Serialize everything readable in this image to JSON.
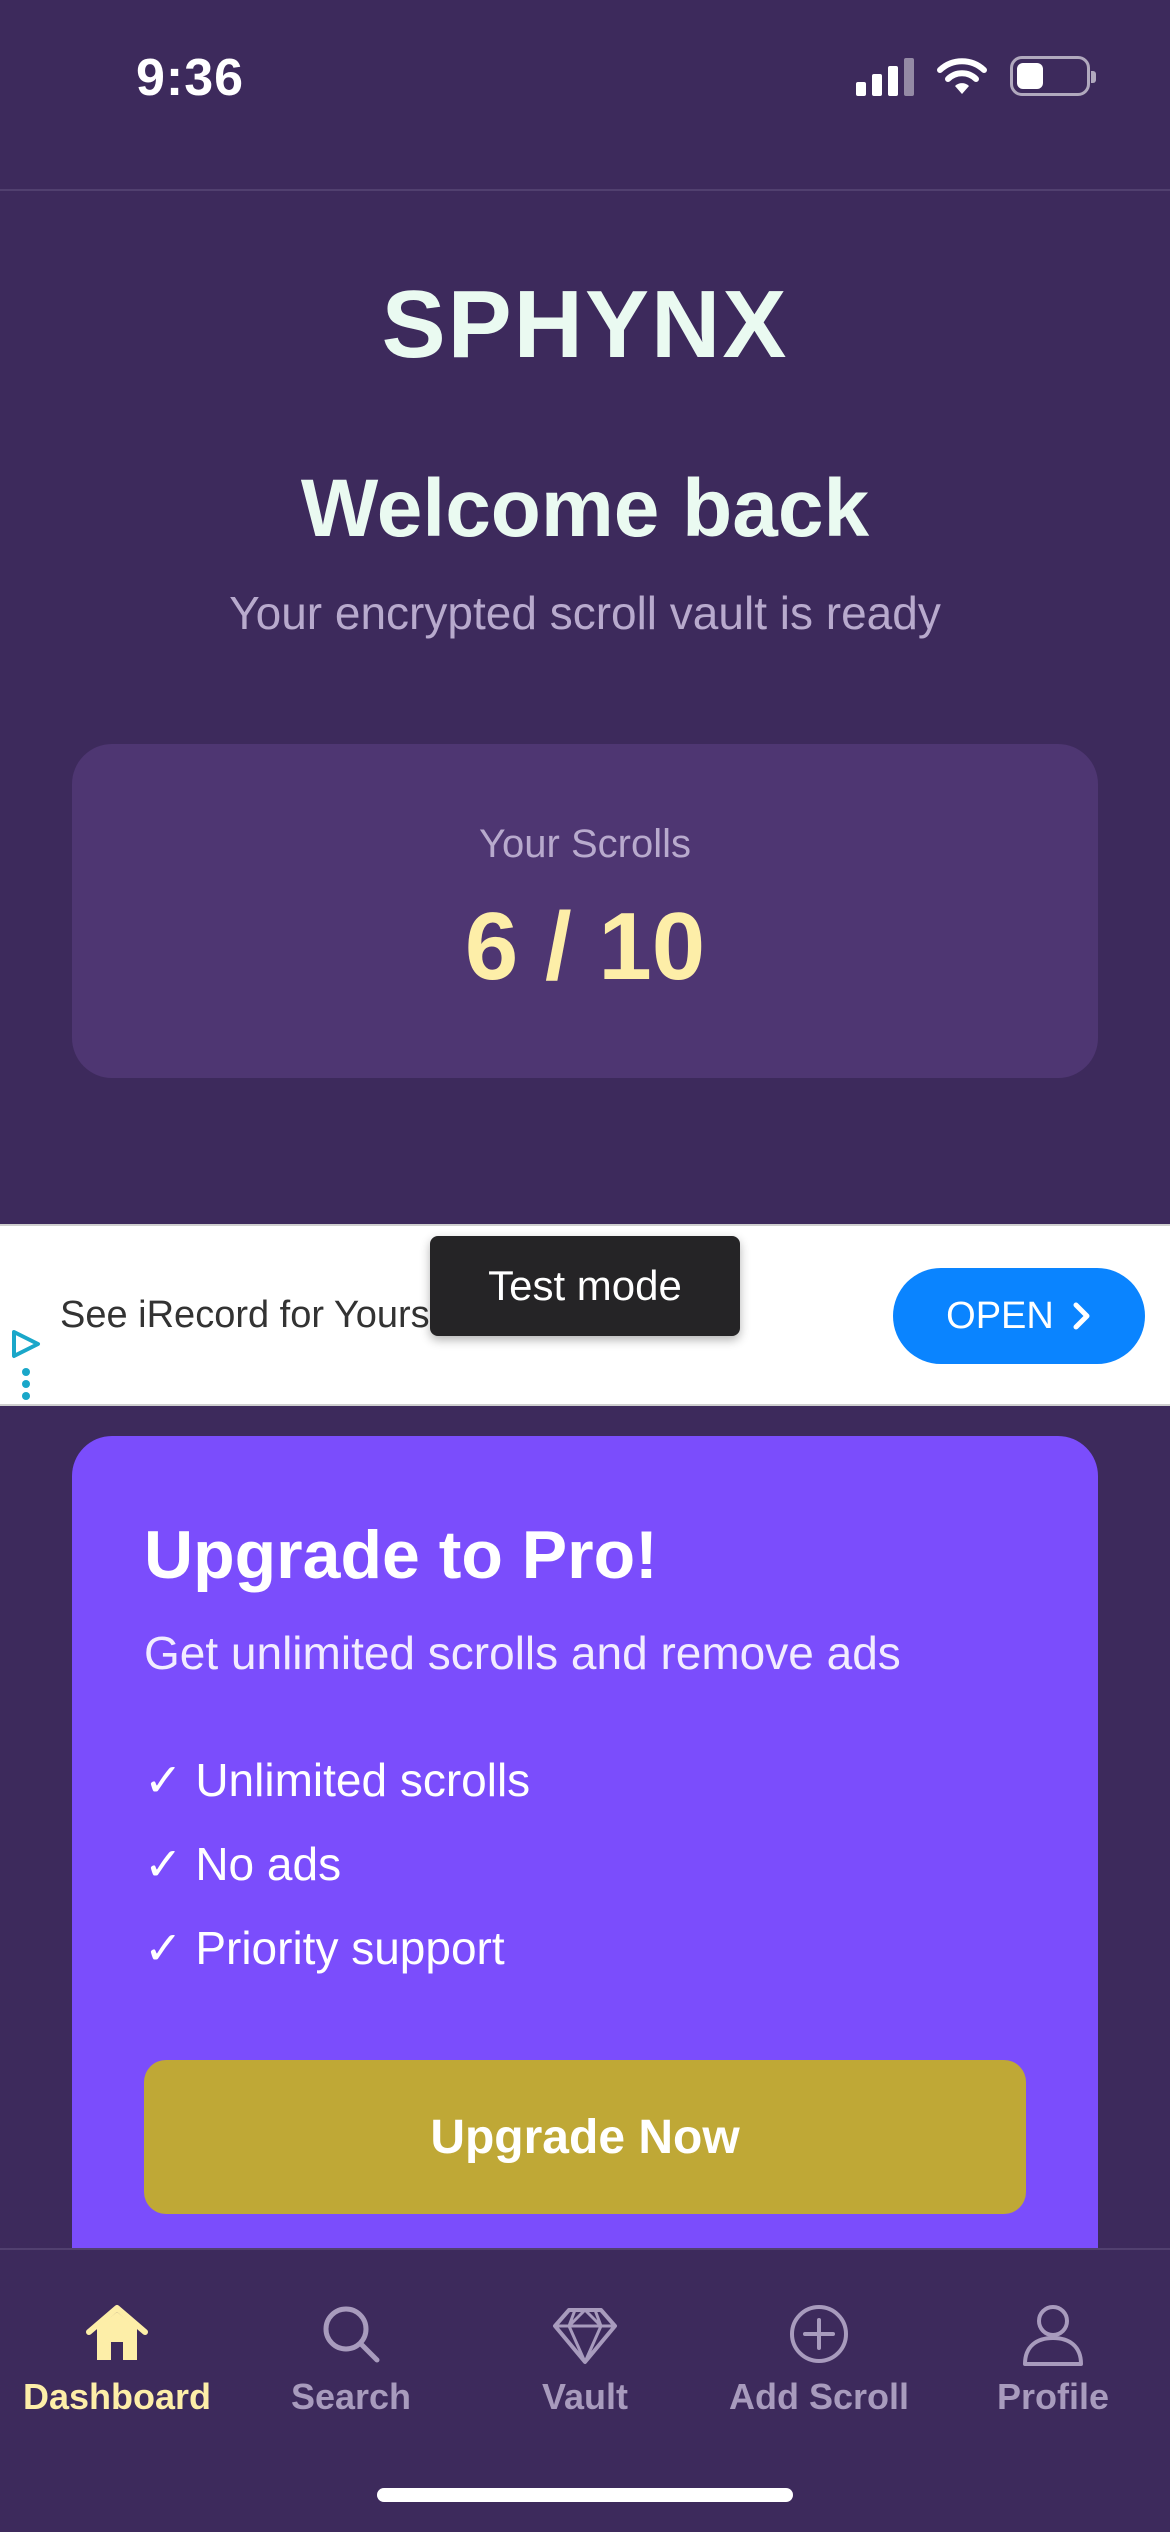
{
  "status_bar": {
    "time": "9:36"
  },
  "header": {
    "app_title": "SPHYNX",
    "welcome": "Welcome back",
    "subtitle": "Your encrypted scroll vault is ready"
  },
  "scroll_card": {
    "label": "Your Scrolls",
    "count": "6 / 10"
  },
  "ad": {
    "text": "See iRecord for Yours",
    "test_mode_label": "Test mode",
    "open_label": "OPEN"
  },
  "pro_card": {
    "title": "Upgrade to Pro!",
    "subtitle": "Get unlimited scrolls and remove ads",
    "features": [
      "✓ Unlimited scrolls",
      "✓ No ads",
      "✓ Priority support"
    ],
    "button_label": "Upgrade Now"
  },
  "tab_bar": {
    "tabs": [
      {
        "label": "Dashboard",
        "icon": "home-icon",
        "active": true
      },
      {
        "label": "Search",
        "icon": "search-icon",
        "active": false
      },
      {
        "label": "Vault",
        "icon": "diamond-icon",
        "active": false
      },
      {
        "label": "Add Scroll",
        "icon": "plus-circle-icon",
        "active": false
      },
      {
        "label": "Profile",
        "icon": "user-icon",
        "active": false
      }
    ]
  },
  "colors": {
    "background": "#3d2a5c",
    "card": "#4e3672",
    "accent_yellow": "#fdeea8",
    "pro_purple": "#7b4dfc",
    "upgrade_gold": "#bfa836",
    "ad_blue": "#0a84ff"
  }
}
